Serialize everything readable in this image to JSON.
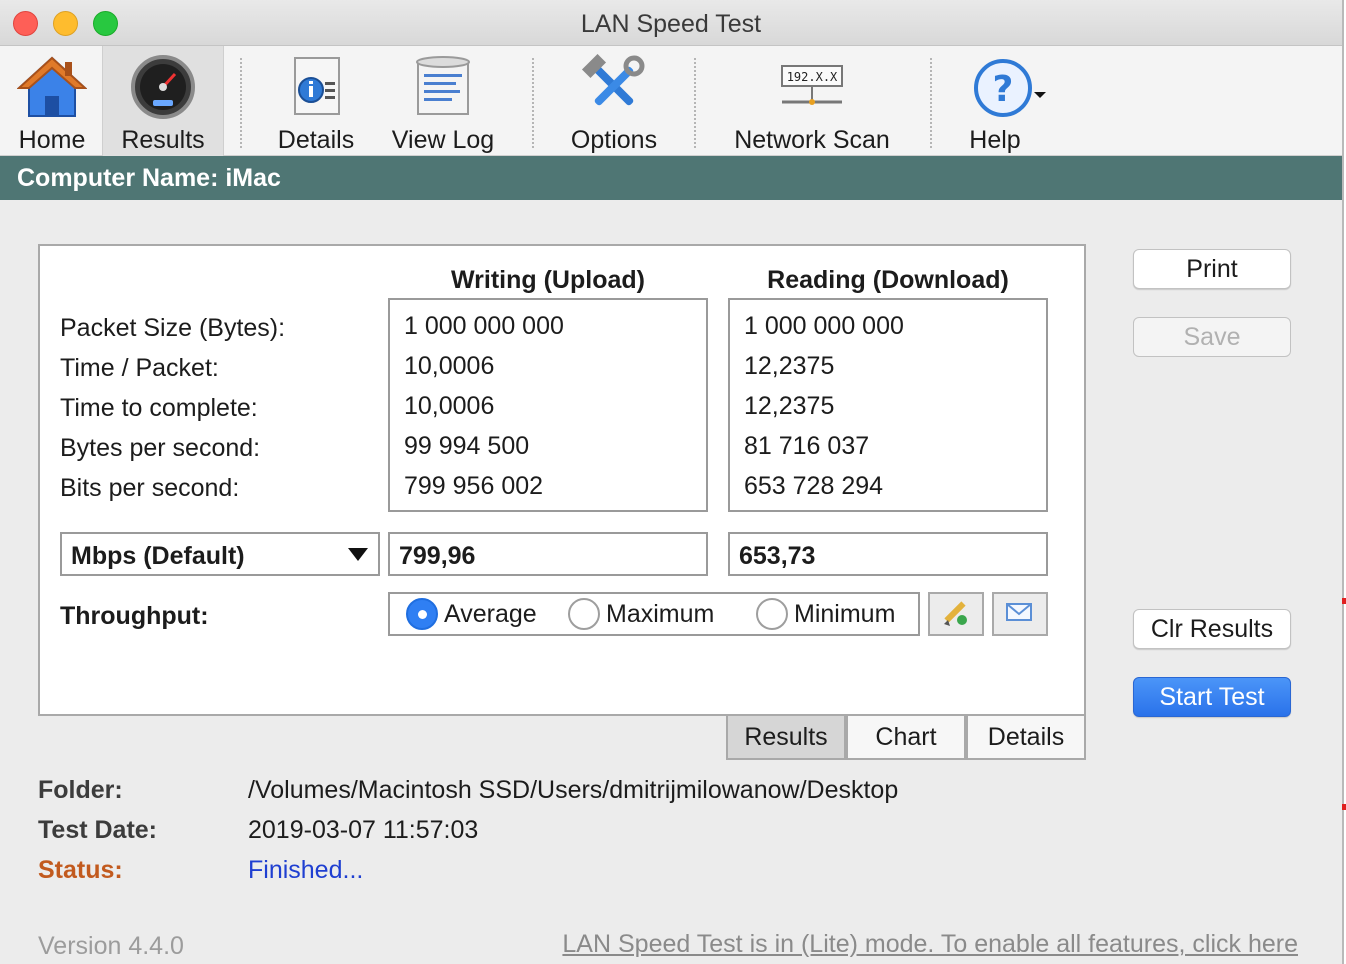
{
  "window": {
    "title": "LAN Speed Test"
  },
  "toolbar": {
    "home": "Home",
    "results": "Results",
    "details": "Details",
    "view_log": "View Log",
    "options": "Options",
    "network_scan": "Network Scan",
    "network_scan_icon_text": "192.X.X",
    "help": "Help"
  },
  "computer": {
    "label": "Computer Name: iMac"
  },
  "results": {
    "writing_header": "Writing (Upload)",
    "reading_header": "Reading (Download)",
    "row_labels": [
      "Packet Size (Bytes):",
      "Time / Packet:",
      "Time to complete:",
      "Bytes per second:",
      "Bits per second:"
    ],
    "writing_values": [
      "1 000 000 000",
      "10,0006",
      "10,0006",
      "99 994 500",
      "799 956 002"
    ],
    "reading_values": [
      "1 000 000 000",
      "12,2375",
      "12,2375",
      "81 716 037",
      "653 728 294"
    ],
    "unit_select": "Mbps (Default)",
    "writing_mbps": "799,96",
    "reading_mbps": "653,73",
    "throughput_label": "Throughput:",
    "radio_options": [
      {
        "label": "Average",
        "selected": true
      },
      {
        "label": "Maximum",
        "selected": false
      },
      {
        "label": "Minimum",
        "selected": false
      }
    ]
  },
  "tabs": [
    "Results",
    "Chart",
    "Details"
  ],
  "active_tab": "Results",
  "side_buttons": {
    "print": "Print",
    "save": "Save",
    "clr_results": "Clr Results",
    "start_test": "Start Test"
  },
  "info": {
    "folder_label": "Folder:",
    "folder_value": "/Volumes/Macintosh SSD/Users/dmitrijmilowanow/Desktop",
    "date_label": "Test Date:",
    "date_value": "2019-03-07 11:57:03",
    "status_label": "Status:",
    "status_value": "Finished..."
  },
  "footer": {
    "version": "Version 4.4.0",
    "lite_link": "LAN Speed Test is in (Lite) mode.  To enable all features, click here"
  },
  "colors": {
    "namebar": "#4f7674",
    "status_label": "#c25a1e",
    "status_value": "#1f3fd1",
    "primary_button": "#2a72ea"
  }
}
